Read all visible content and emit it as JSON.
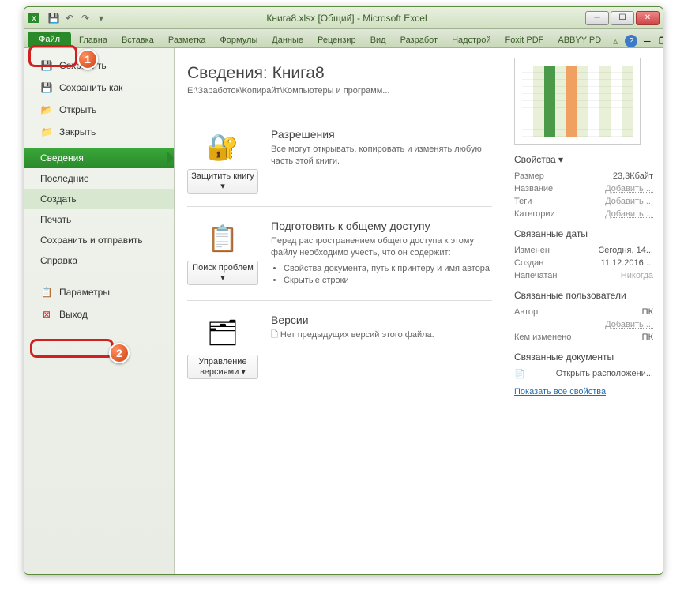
{
  "title": "Книга8.xlsx  [Общий]  -  Microsoft Excel",
  "tabs": {
    "file": "Файл",
    "home": "Главна",
    "insert": "Вставка",
    "layout": "Разметка",
    "formulas": "Формулы",
    "data": "Данные",
    "review": "Рецензир",
    "view": "Вид",
    "dev": "Разработ",
    "addins": "Надстрой",
    "foxit": "Foxit PDF",
    "abbyy": "ABBYY PD"
  },
  "sidebar": {
    "save": "Сохранить",
    "saveas": "Сохранить как",
    "open": "Открыть",
    "close": "Закрыть",
    "info": "Сведения",
    "recent": "Последние",
    "new": "Создать",
    "print": "Печать",
    "share": "Сохранить и отправить",
    "help": "Справка",
    "options": "Параметры",
    "exit": "Выход"
  },
  "info": {
    "title": "Сведения: Книга8",
    "path": "E:\\Заработок\\Копирайт\\Компьютеры и программ...",
    "perm_btn": "Защитить книгу",
    "perm_title": "Разрешения",
    "perm_text": "Все могут открывать, копировать и изменять любую часть этой книги.",
    "prep_btn": "Поиск проблем",
    "prep_title": "Подготовить к общему доступу",
    "prep_text": "Перед распространением общего доступа к этому файлу необходимо учесть, что он содержит:",
    "prep_li1": "Свойства документа, путь к принтеру и имя автора",
    "prep_li2": "Скрытые строки",
    "ver_btn": "Управление версиями",
    "ver_title": "Версии",
    "ver_text": "Нет предыдущих версий этого файла."
  },
  "props": {
    "header": "Свойства",
    "size_l": "Размер",
    "size_v": "23,3Кбайт",
    "name_l": "Название",
    "name_v": "Добавить ...",
    "tags_l": "Теги",
    "tags_v": "Добавить ...",
    "cat_l": "Категории",
    "cat_v": "Добавить ...",
    "dates_h": "Связанные даты",
    "mod_l": "Изменен",
    "mod_v": "Сегодня, 14...",
    "cre_l": "Создан",
    "cre_v": "11.12.2016 ...",
    "prn_l": "Напечатан",
    "prn_v": "Никогда",
    "users_h": "Связанные пользователи",
    "auth_l": "Автор",
    "auth_v": "ПК",
    "auth_add": "Добавить ...",
    "mby_l": "Кем изменено",
    "mby_v": "ПК",
    "docs_h": "Связанные документы",
    "loc": "Открыть расположени...",
    "all": "Показать все свойства"
  },
  "badges": {
    "one": "1",
    "two": "2"
  }
}
